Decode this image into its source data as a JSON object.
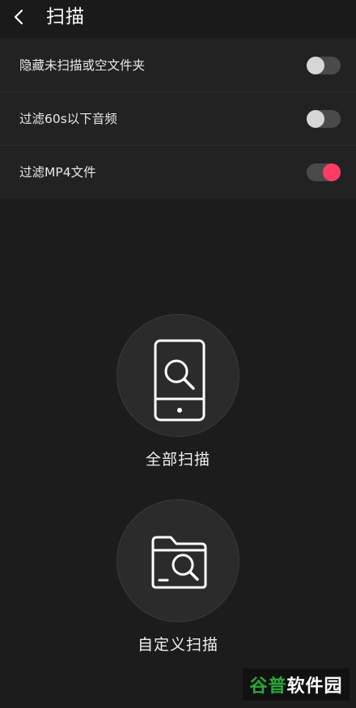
{
  "header": {
    "title": "扫描",
    "back_icon": "chevron-left-icon"
  },
  "settings": [
    {
      "label": "隐藏未扫描或空文件夹",
      "enabled": false
    },
    {
      "label": "过滤60s以下音频",
      "enabled": false
    },
    {
      "label": "过滤MP4文件",
      "enabled": true
    }
  ],
  "actions": {
    "full_scan": {
      "label": "全部扫描",
      "icon": "phone-search-icon"
    },
    "custom_scan": {
      "label": "自定义扫描",
      "icon": "folder-search-icon"
    }
  },
  "watermark": {
    "part_a": "谷普",
    "part_b": "软件园"
  },
  "colors": {
    "accent": "#ff3d64",
    "background": "#1c1c1c",
    "toggle_off_track": "#4a4a4a",
    "toggle_off_knob": "#d6d6d6"
  }
}
